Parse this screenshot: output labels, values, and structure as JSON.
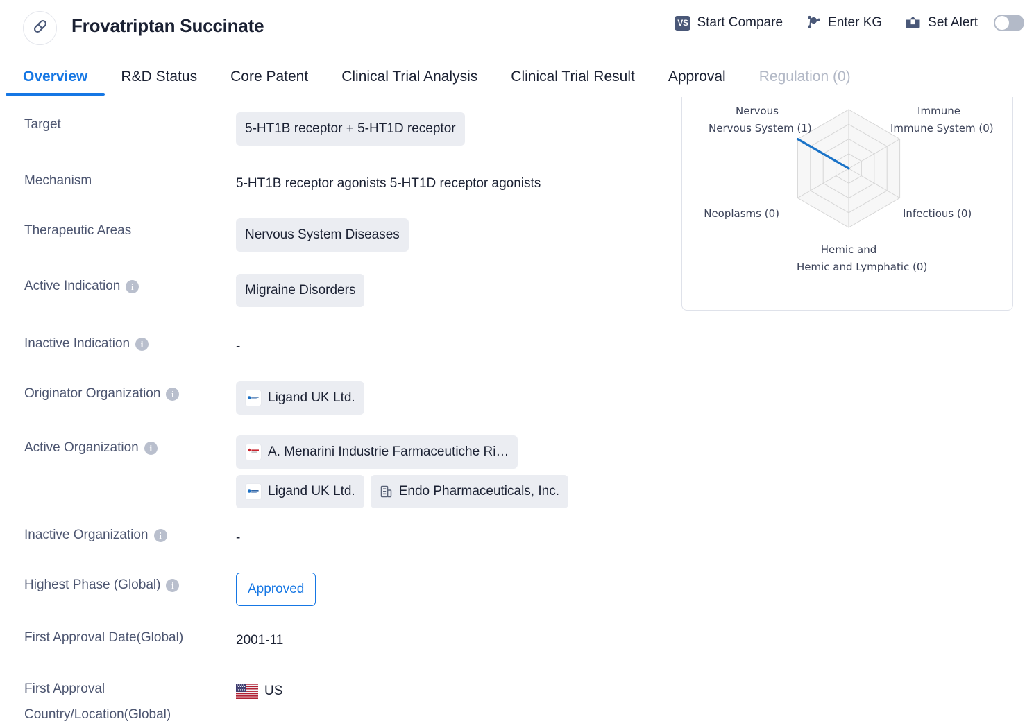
{
  "header": {
    "drug_icon": "pill-capsule-icon",
    "title": "Frovatriptan Succinate",
    "actions": [
      {
        "icon": "vs-compare-icon",
        "badge": "VS",
        "label": "Start Compare"
      },
      {
        "icon": "knowledge-graph-icon",
        "label": "Enter KG"
      },
      {
        "icon": "alert-inbox-icon",
        "label": "Set Alert"
      }
    ],
    "alert_toggle": {
      "state": "off"
    }
  },
  "tabs": [
    {
      "label": "Overview",
      "active": true
    },
    {
      "label": "R&D Status",
      "active": false
    },
    {
      "label": "Core Patent",
      "active": false
    },
    {
      "label": "Clinical Trial Analysis",
      "active": false
    },
    {
      "label": "Clinical Trial Result",
      "active": false
    },
    {
      "label": "Approval",
      "active": false
    },
    {
      "label": "Regulation (0)",
      "active": false,
      "disabled": true
    }
  ],
  "fields": {
    "target": {
      "label": "Target",
      "chip": "5-HT1B receptor + 5-HT1D receptor"
    },
    "mechanism": {
      "label": "Mechanism",
      "value": "5-HT1B receptor agonists  5-HT1D receptor agonists"
    },
    "therapeutic_areas": {
      "label": "Therapeutic Areas",
      "chip": "Nervous System Diseases"
    },
    "active_indication": {
      "label": "Active Indication",
      "info": "info-icon",
      "chip": "Migraine Disorders"
    },
    "inactive_indication": {
      "label": "Inactive Indication",
      "info": "info-icon",
      "value": "-"
    },
    "originator_organization": {
      "label": "Originator Organization",
      "info": "info-icon",
      "chips": [
        {
          "logo": "ligand-logo",
          "name": "Ligand UK Ltd."
        }
      ]
    },
    "active_organization": {
      "label": "Active Organization",
      "info": "info-icon",
      "chips": [
        {
          "logo": "menarini-logo",
          "name": "A. Menarini Industrie Farmaceutiche Ri…"
        },
        {
          "logo": "ligand-logo",
          "name": "Ligand UK Ltd."
        },
        {
          "logo": "building-icon",
          "name": "Endo Pharmaceuticals, Inc."
        }
      ]
    },
    "inactive_organization": {
      "label": "Inactive Organization",
      "info": "info-icon",
      "value": "-"
    },
    "highest_phase": {
      "label": "Highest Phase (Global)",
      "info": "info-icon",
      "pill": "Approved"
    },
    "first_approval_date": {
      "label": "First Approval Date(Global)",
      "value": "2001-11"
    },
    "first_approval_country": {
      "label_line1": "First Approval",
      "label_line2": "Country/Location(Global)",
      "flag": "us-flag-icon",
      "value": "US"
    }
  },
  "chart_data": {
    "type": "radar",
    "title": "",
    "categories": [
      "Nervous System (1)",
      "Immune System (0)",
      "Infectious (0)",
      "Hemic and Lymphatic (0)",
      "Neoplasms (0)",
      "Immune System (0)"
    ],
    "axes": [
      {
        "label": "Nervous System (1)",
        "value": 1,
        "angle_deg": 240
      },
      {
        "label": "Immune System (0)",
        "value": 0,
        "angle_deg": 300
      },
      {
        "label": "Infectious (0)",
        "value": 0,
        "angle_deg": 0
      },
      {
        "label": "Hemic and Lymphatic (0)",
        "value": 0,
        "angle_deg": 60
      },
      {
        "label": "Neoplasms (0)",
        "value": 0,
        "angle_deg": 180
      }
    ],
    "labels": [
      "Nervous System (1)",
      "Immune System (0)",
      "Infectious (0)",
      "Hemic and Lymphatic (0)",
      "Neoplasms (0)"
    ],
    "values": [
      1,
      0,
      0,
      0,
      0
    ],
    "rings": 4,
    "rmax": 1,
    "series_color": "#1a73c8",
    "grid_color": "#d6d6d6",
    "grid": true,
    "legend": "none"
  },
  "colors": {
    "accent": "#1677e4",
    "chip_bg": "#ebedf2",
    "label_text": "#4c5570",
    "value_text": "#1b2133",
    "muted": "#b2b8c6",
    "icon_slate": "#4a5878",
    "radar_line": "#1a73c8"
  }
}
